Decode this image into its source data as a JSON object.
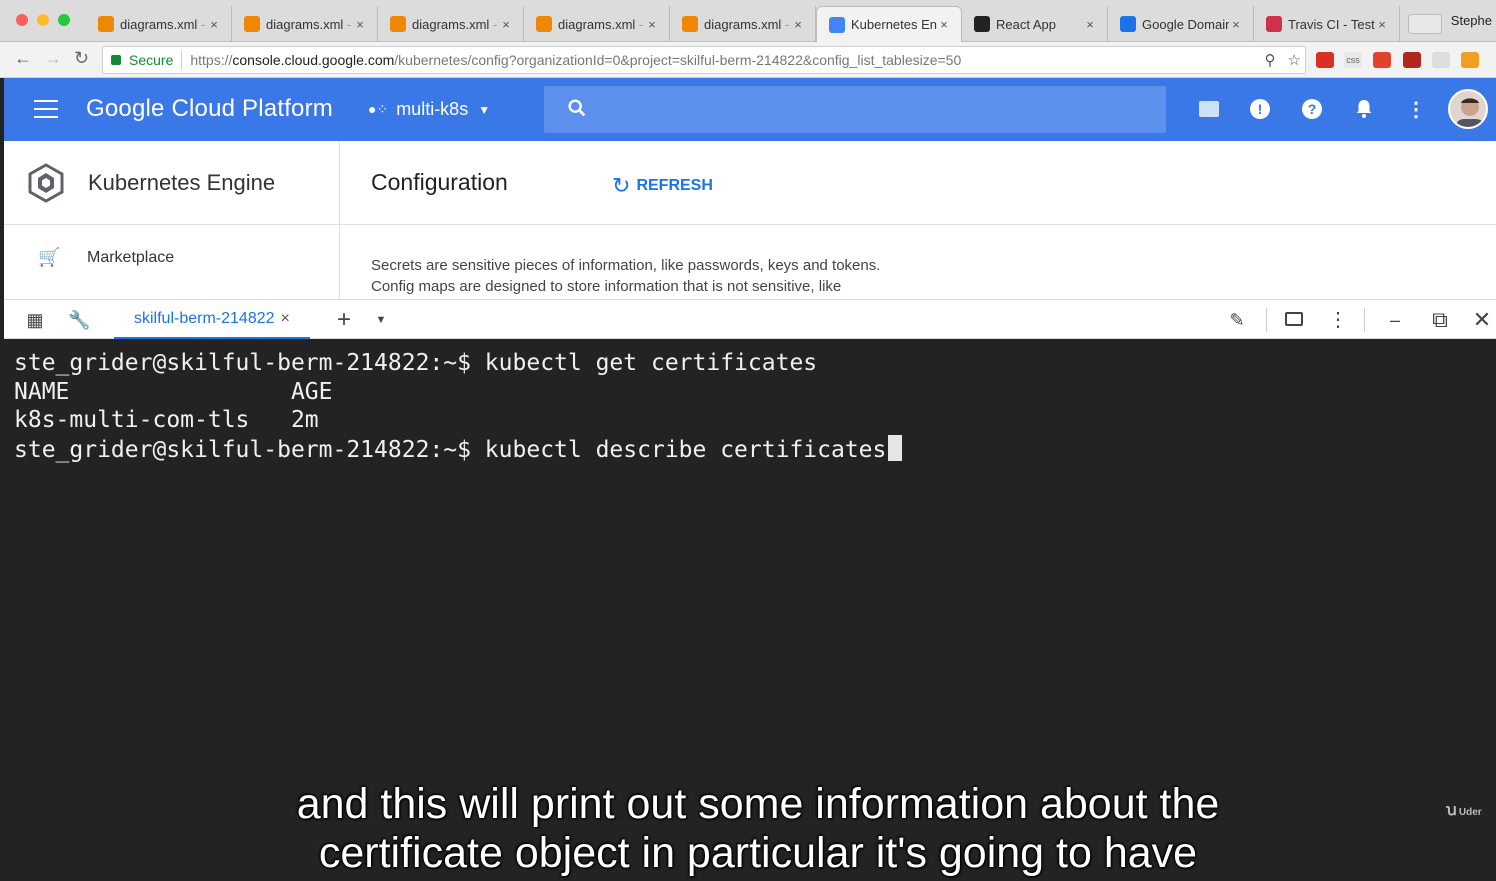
{
  "browser": {
    "tabs": [
      {
        "label": "diagrams.xml",
        "suffix": " -",
        "icon": "drawio-icon",
        "color": "#f08705"
      },
      {
        "label": "diagrams.xml",
        "suffix": " -",
        "icon": "drawio-icon",
        "color": "#f08705"
      },
      {
        "label": "diagrams.xml",
        "suffix": " -",
        "icon": "drawio-icon",
        "color": "#f08705"
      },
      {
        "label": "diagrams.xml",
        "suffix": " -",
        "icon": "drawio-icon",
        "color": "#f08705"
      },
      {
        "label": "diagrams.xml",
        "suffix": " -",
        "icon": "drawio-icon",
        "color": "#f08705"
      },
      {
        "label": "Kubernetes En",
        "suffix": "",
        "icon": "kubernetes-icon",
        "color": "#4285f4",
        "active": true
      },
      {
        "label": "React App",
        "suffix": "",
        "icon": "react-icon",
        "color": "#222"
      },
      {
        "label": "Google Domain",
        "suffix": "",
        "icon": "google-domains-icon",
        "color": "#1a73e8"
      },
      {
        "label": "Travis CI - Test",
        "suffix": "",
        "icon": "travis-icon",
        "color": "#cd324a"
      }
    ],
    "close_glyph": "×",
    "profile_name": "Stephe",
    "secure_label": "Secure",
    "url_scheme": "https://",
    "url_host": "console.cloud.google.com",
    "url_path": "/kubernetes/config?organizationId=0&project=skilful-berm-214822&config_list_tablesize=50"
  },
  "gcp": {
    "title": "Google Cloud Platform",
    "project": "multi-k8s"
  },
  "console": {
    "product": "Kubernetes Engine",
    "nav_item": "Marketplace",
    "page_title": "Configuration",
    "refresh_label": "REFRESH",
    "description": [
      "Secrets are sensitive pieces of information, like passwords, keys and tokens.",
      "Config maps are designed to store information that is not sensitive, like"
    ]
  },
  "shell": {
    "tab_label": "skilful-berm-214822",
    "tab_close": "×",
    "add_label": "+"
  },
  "terminal": {
    "lines": [
      "ste_grider@skilful-berm-214822:~$ kubectl get certificates",
      "NAME                AGE",
      "k8s-multi-com-tls   2m",
      "ste_grider@skilful-berm-214822:~$ kubectl describe certificates"
    ]
  },
  "captions": [
    "and this will print out some information about the",
    "certificate object in particular it's going to have"
  ],
  "watermark": {
    "mark": "ꭒ",
    "text": "Uder"
  },
  "colors": {
    "gcp_blue": "#3b78e7",
    "search_blue": "#5d8fec",
    "link_blue": "#1a73e8",
    "terminal_bg": "#232323",
    "secure_green": "#138a36"
  }
}
